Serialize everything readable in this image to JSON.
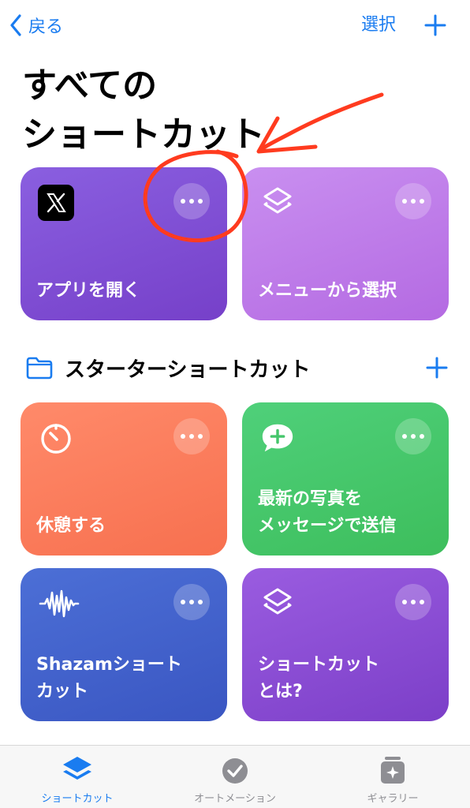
{
  "nav": {
    "back_label": "戻る",
    "select_label": "選択"
  },
  "title": "すべての\nショートカット",
  "cards_top": [
    {
      "title": "アプリを開く",
      "icon": "x-app-icon",
      "color": "#7f4fd4"
    },
    {
      "title": "メニューから選択",
      "icon": "layers-icon",
      "color": "#bf7ee9"
    }
  ],
  "section": {
    "title": "スターターショートカット"
  },
  "cards_starter": [
    {
      "title": "休憩する",
      "icon": "timer-icon",
      "color": "#f97c5c"
    },
    {
      "title": "最新の写真を\nメッセージで送信",
      "icon": "message-plus-icon",
      "color": "#45c66b"
    },
    {
      "title": "Shazamショート\nカット",
      "icon": "waveform-icon",
      "color": "#4262cc"
    },
    {
      "title": "ショートカット\nとは?",
      "icon": "layers-icon",
      "color": "#8a4dd4"
    }
  ],
  "tabs": [
    {
      "label": "ショートカット",
      "icon": "shortcuts-stack-icon",
      "active": true
    },
    {
      "label": "オートメーション",
      "icon": "automation-check-icon",
      "active": false
    },
    {
      "label": "ギャラリー",
      "icon": "gallery-sparkle-icon",
      "active": false
    }
  ],
  "colors": {
    "accent": "#1a7cf0",
    "annotation": "#ff3b1f"
  }
}
